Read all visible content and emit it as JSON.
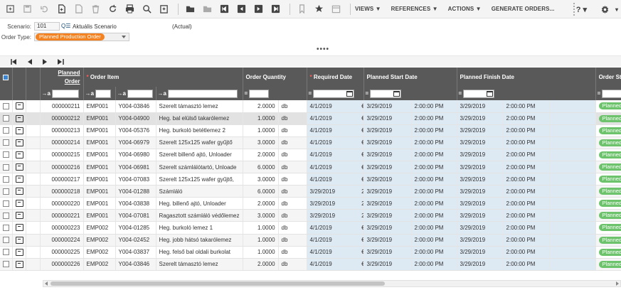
{
  "toolbar": {
    "menus": [
      "VIEWS ▼",
      "REFERENCES ▼",
      "ACTIONS ▼",
      "GENERATE ORDERS..."
    ],
    "help_label": "? ▾"
  },
  "scenario": {
    "label": "Scenario:",
    "value": "101",
    "name": "Aktuális Scenario",
    "actual": "(Actual)"
  },
  "order_type": {
    "label": "Order Type:",
    "value": "Planned Production Order"
  },
  "more_indicator": "••••",
  "columns": {
    "planned_order": [
      "Planned",
      "Order"
    ],
    "order_item": "Order Item",
    "order_quantity": "Order Quantity",
    "required_date": "Required Date",
    "planned_start_date": "Planned Start Date",
    "planned_finish_date": "Planned Finish Date",
    "order_status": "Order Status"
  },
  "filter_ops": {
    "text": "→a",
    "equals": "="
  },
  "colors": {
    "status_green": "#6cc36c",
    "order_type_orange": "#f58220",
    "header_gray": "#595959",
    "date_blue": "#dde9f3"
  },
  "rows": [
    {
      "order": "000000211",
      "site": "EMP001",
      "item": "Y004-03846",
      "desc": "Szerelt támasztó lemez",
      "qty": "2.0000",
      "uom": "db",
      "req": "4/1/2019",
      "req_t": "€",
      "start": "3/29/2019",
      "start_t": "2:00:00 PM",
      "finish": "3/29/2019",
      "finish_t": "2:00:00 PM",
      "status": "Planned"
    },
    {
      "order": "000000212",
      "site": "EMP001",
      "item": "Y004-04900",
      "desc": "Heg. bal elülső takarólemez",
      "qty": "1.0000",
      "uom": "db",
      "req": "4/1/2019",
      "req_t": "€",
      "start": "3/29/2019",
      "start_t": "2:00:00 PM",
      "finish": "3/29/2019",
      "finish_t": "2:00:00 PM",
      "status": "Planned"
    },
    {
      "order": "000000213",
      "site": "EMP001",
      "item": "Y004-05376",
      "desc": "Heg. burkoló betétlemez 2",
      "qty": "1.0000",
      "uom": "db",
      "req": "4/1/2019",
      "req_t": "€",
      "start": "3/29/2019",
      "start_t": "2:00:00 PM",
      "finish": "3/29/2019",
      "finish_t": "2:00:00 PM",
      "status": "Planned"
    },
    {
      "order": "000000214",
      "site": "EMP001",
      "item": "Y004-06979",
      "desc": "Szerelt 125x125 wafer gyűjtő",
      "qty": "3.0000",
      "uom": "db",
      "req": "4/1/2019",
      "req_t": "€",
      "start": "3/29/2019",
      "start_t": "2:00:00 PM",
      "finish": "3/29/2019",
      "finish_t": "2:00:00 PM",
      "status": "Planned"
    },
    {
      "order": "000000215",
      "site": "EMP001",
      "item": "Y004-06980",
      "desc": "Szerelt billenő ajtó, Unloader",
      "qty": "2.0000",
      "uom": "db",
      "req": "4/1/2019",
      "req_t": "€",
      "start": "3/29/2019",
      "start_t": "2:00:00 PM",
      "finish": "3/29/2019",
      "finish_t": "2:00:00 PM",
      "status": "Planned"
    },
    {
      "order": "000000216",
      "site": "EMP001",
      "item": "Y004-06981",
      "desc": "Szerelt számlálótartó, Unloade",
      "qty": "6.0000",
      "uom": "db",
      "req": "4/1/2019",
      "req_t": "€",
      "start": "3/29/2019",
      "start_t": "2:00:00 PM",
      "finish": "3/29/2019",
      "finish_t": "2:00:00 PM",
      "status": "Planned"
    },
    {
      "order": "000000217",
      "site": "EMP001",
      "item": "Y004-07083",
      "desc": "Szerelt 125x125 wafer gyűjtő,",
      "qty": "3.0000",
      "uom": "db",
      "req": "4/1/2019",
      "req_t": "€",
      "start": "3/29/2019",
      "start_t": "2:00:00 PM",
      "finish": "3/29/2019",
      "finish_t": "2:00:00 PM",
      "status": "Planned"
    },
    {
      "order": "000000218",
      "site": "EMP001",
      "item": "Y004-01288",
      "desc": "Számláló",
      "qty": "6.0000",
      "uom": "db",
      "req": "3/29/2019",
      "req_t": "2",
      "start": "3/29/2019",
      "start_t": "2:00:00 PM",
      "finish": "3/29/2019",
      "finish_t": "2:00:00 PM",
      "status": "Planned"
    },
    {
      "order": "000000220",
      "site": "EMP001",
      "item": "Y004-03838",
      "desc": "Heg. billenő ajtó, Unloader",
      "qty": "2.0000",
      "uom": "db",
      "req": "3/29/2019",
      "req_t": "2",
      "start": "3/29/2019",
      "start_t": "2:00:00 PM",
      "finish": "3/29/2019",
      "finish_t": "2:00:00 PM",
      "status": "Planned"
    },
    {
      "order": "000000221",
      "site": "EMP001",
      "item": "Y004-07081",
      "desc": "Ragasztott számláló védőlemez",
      "qty": "3.0000",
      "uom": "db",
      "req": "3/29/2019",
      "req_t": "2",
      "start": "3/29/2019",
      "start_t": "2:00:00 PM",
      "finish": "3/29/2019",
      "finish_t": "2:00:00 PM",
      "status": "Planned"
    },
    {
      "order": "000000223",
      "site": "EMP002",
      "item": "Y004-01285",
      "desc": "Heg. burkoló lemez 1",
      "qty": "1.0000",
      "uom": "db",
      "req": "4/1/2019",
      "req_t": "€",
      "start": "3/29/2019",
      "start_t": "2:00:00 PM",
      "finish": "3/29/2019",
      "finish_t": "2:00:00 PM",
      "status": "Planned"
    },
    {
      "order": "000000224",
      "site": "EMP002",
      "item": "Y004-02452",
      "desc": "Heg. jobb hátsó takarólemez",
      "qty": "1.0000",
      "uom": "db",
      "req": "4/1/2019",
      "req_t": "€",
      "start": "3/29/2019",
      "start_t": "2:00:00 PM",
      "finish": "3/29/2019",
      "finish_t": "2:00:00 PM",
      "status": "Planned"
    },
    {
      "order": "000000225",
      "site": "EMP002",
      "item": "Y004-03837",
      "desc": "Heg. felső bal oldali burkolat",
      "qty": "1.0000",
      "uom": "db",
      "req": "4/1/2019",
      "req_t": "€",
      "start": "3/29/2019",
      "start_t": "2:00:00 PM",
      "finish": "3/29/2019",
      "finish_t": "2:00:00 PM",
      "status": "Planned"
    },
    {
      "order": "000000226",
      "site": "EMP002",
      "item": "Y004-03846",
      "desc": "Szerelt támasztó lemez",
      "qty": "2.0000",
      "uom": "db",
      "req": "4/1/2019",
      "req_t": "€",
      "start": "3/29/2019",
      "start_t": "2:00:00 PM",
      "finish": "3/29/2019",
      "finish_t": "2:00:00 PM",
      "status": "Planned"
    }
  ]
}
